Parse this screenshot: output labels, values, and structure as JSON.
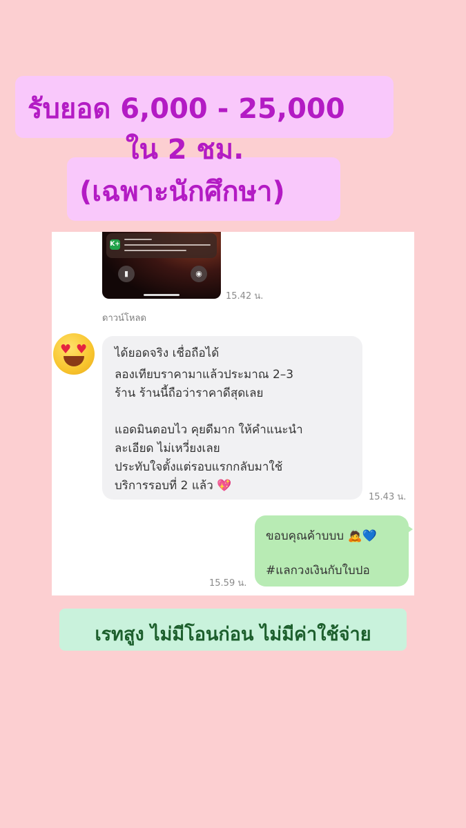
{
  "headline": {
    "line1": "รับยอด 6,000 - 25,000",
    "line2": "ใน 2 ชม.",
    "line3": "(เฉพาะนักศึกษา)"
  },
  "chat": {
    "image_timestamp": "15.42 น.",
    "download_label": "ดาวน์โหลด",
    "received_message": {
      "lines": [
        "ได้ยอดจริง เชื่อถือได้",
        "ลองเทียบราคามาแล้วประมาณ 2–3",
        "ร้าน ร้านนี้ถือว่าราคาดีสุดเลย",
        "แอดมินตอบไว คุยดีมาก ให้คำแนะนำ",
        "ละเอียด ไม่เหวี่ยงเลย",
        "ประทับใจตั้งแต่รอบแรกกลับมาใช้",
        "บริการรอบที่ 2 แล้ว 💖"
      ],
      "timestamp": "15.43 น."
    },
    "sent_message": {
      "lines": [
        "ขอบคุณค้าบบบ 🙇💙",
        "#แลกวงเงินกับใบปอ"
      ],
      "timestamp": "15.59 น."
    }
  },
  "footer": {
    "text": "เรทสูง ไม่มีโอนก่อน ไม่มีค่าใช้จ่าย"
  },
  "colors": {
    "background": "#fccfd1",
    "headline_highlight": "#f9c8fb",
    "headline_text": "#b31bc4",
    "sent_bubble": "#b8ebb4",
    "footer_box": "#c9f2dc",
    "footer_text": "#1d5f2d"
  }
}
